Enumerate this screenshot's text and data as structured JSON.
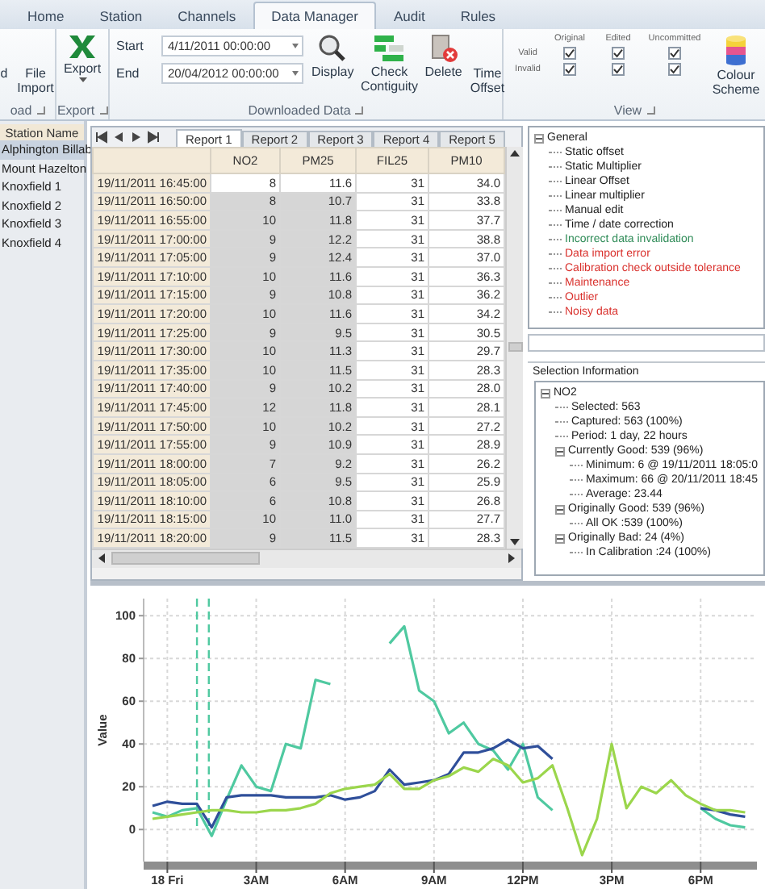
{
  "ribbon": {
    "tabs": [
      {
        "label": "Home",
        "selected": false
      },
      {
        "label": "Station",
        "selected": false
      },
      {
        "label": "Channels",
        "selected": false
      },
      {
        "label": "Data Manager",
        "selected": true
      },
      {
        "label": "Audit",
        "selected": false
      },
      {
        "label": "Rules",
        "selected": false
      }
    ],
    "load_group": {
      "label": "oad",
      "buttons": [
        "d",
        "File Import"
      ]
    },
    "export_group": {
      "label": "Export",
      "button": "Export"
    },
    "downloaded_group": {
      "label": "Downloaded Data",
      "start_label": "Start",
      "start_value": "4/11/2011 00:00:00",
      "end_label": "End",
      "end_value": "20/04/2012 00:00:00",
      "buttons": [
        {
          "kind": "display",
          "label": "Display"
        },
        {
          "kind": "contiguity",
          "label": "Check Contiguity"
        },
        {
          "kind": "delete",
          "label": "Delete"
        },
        {
          "kind": "plain",
          "label": "Time Offset"
        }
      ]
    },
    "view_group": {
      "label": "View",
      "columns": [
        "Original",
        "Edited",
        "Uncommitted"
      ],
      "rows": [
        {
          "label": "Valid",
          "checks": [
            true,
            true,
            true
          ]
        },
        {
          "label": "Invalid",
          "checks": [
            true,
            true,
            true
          ]
        }
      ],
      "button": "Colour Scheme"
    }
  },
  "stations": {
    "header": "Station Name",
    "items": [
      {
        "label": "Alphington Billab",
        "selected": true
      },
      {
        "label": "Mount Hazelton",
        "selected": false
      },
      {
        "label": "Knoxfield 1",
        "selected": false
      },
      {
        "label": "Knoxfield 2",
        "selected": false
      },
      {
        "label": "Knoxfield 3",
        "selected": false
      },
      {
        "label": "Knoxfield 4",
        "selected": false
      }
    ]
  },
  "report_tabs": [
    {
      "label": "Report 1",
      "selected": true
    },
    {
      "label": "Report 2",
      "selected": false
    },
    {
      "label": "Report 3",
      "selected": false
    },
    {
      "label": "Report 4",
      "selected": false
    },
    {
      "label": "Report 5",
      "selected": false
    }
  ],
  "table": {
    "columns": [
      "NO2",
      "PM25",
      "FIL25",
      "PM10"
    ],
    "rows": [
      {
        "time": "19/11/2011 16:45:00",
        "values": [
          "8",
          "11.6",
          "31",
          "34.0"
        ],
        "selected": false
      },
      {
        "time": "19/11/2011 16:50:00",
        "values": [
          "8",
          "10.7",
          "31",
          "33.8"
        ],
        "selected": true
      },
      {
        "time": "19/11/2011 16:55:00",
        "values": [
          "10",
          "11.8",
          "31",
          "37.7"
        ],
        "selected": true
      },
      {
        "time": "19/11/2011 17:00:00",
        "values": [
          "9",
          "12.2",
          "31",
          "38.8"
        ],
        "selected": true
      },
      {
        "time": "19/11/2011 17:05:00",
        "values": [
          "9",
          "12.4",
          "31",
          "37.0"
        ],
        "selected": true
      },
      {
        "time": "19/11/2011 17:10:00",
        "values": [
          "10",
          "11.6",
          "31",
          "36.3"
        ],
        "selected": true
      },
      {
        "time": "19/11/2011 17:15:00",
        "values": [
          "9",
          "10.8",
          "31",
          "36.2"
        ],
        "selected": true
      },
      {
        "time": "19/11/2011 17:20:00",
        "values": [
          "10",
          "11.6",
          "31",
          "34.2"
        ],
        "selected": true
      },
      {
        "time": "19/11/2011 17:25:00",
        "values": [
          "9",
          "9.5",
          "31",
          "30.5"
        ],
        "selected": true
      },
      {
        "time": "19/11/2011 17:30:00",
        "values": [
          "10",
          "11.3",
          "31",
          "29.7"
        ],
        "selected": true
      },
      {
        "time": "19/11/2011 17:35:00",
        "values": [
          "10",
          "11.5",
          "31",
          "28.3"
        ],
        "selected": true
      },
      {
        "time": "19/11/2011 17:40:00",
        "values": [
          "9",
          "10.2",
          "31",
          "28.0"
        ],
        "selected": true
      },
      {
        "time": "19/11/2011 17:45:00",
        "values": [
          "12",
          "11.8",
          "31",
          "28.1"
        ],
        "selected": true
      },
      {
        "time": "19/11/2011 17:50:00",
        "values": [
          "10",
          "10.2",
          "31",
          "27.2"
        ],
        "selected": true
      },
      {
        "time": "19/11/2011 17:55:00",
        "values": [
          "9",
          "10.9",
          "31",
          "28.9"
        ],
        "selected": true
      },
      {
        "time": "19/11/2011 18:00:00",
        "values": [
          "7",
          "9.2",
          "31",
          "26.2"
        ],
        "selected": true
      },
      {
        "time": "19/11/2011 18:05:00",
        "values": [
          "6",
          "9.5",
          "31",
          "25.9"
        ],
        "selected": true
      },
      {
        "time": "19/11/2011 18:10:00",
        "values": [
          "6",
          "10.8",
          "31",
          "26.8"
        ],
        "selected": true
      },
      {
        "time": "19/11/2011 18:15:00",
        "values": [
          "10",
          "11.0",
          "31",
          "27.7"
        ],
        "selected": true
      },
      {
        "time": "19/11/2011 18:20:00",
        "values": [
          "9",
          "11.5",
          "31",
          "28.3"
        ],
        "selected": true
      }
    ]
  },
  "flags_tree": [
    {
      "label": "General",
      "expanded": true,
      "children": [
        {
          "label": "Static offset",
          "color": "#1a1a1a"
        },
        {
          "label": "Static Multiplier",
          "color": "#1a1a1a"
        },
        {
          "label": "Linear Offset",
          "color": "#1a1a1a"
        },
        {
          "label": "Linear multiplier",
          "color": "#1a1a1a"
        },
        {
          "label": "Manual edit",
          "color": "#1a1a1a"
        },
        {
          "label": "Time / date correction",
          "color": "#1a1a1a"
        },
        {
          "label": "Incorrect data invalidation",
          "color": "#2e8b57"
        },
        {
          "label": "Data import error",
          "color": "#d9302c"
        },
        {
          "label": "Calibration check outside tolerance",
          "color": "#d9302c"
        },
        {
          "label": "Maintenance",
          "color": "#d9302c"
        },
        {
          "label": "Outlier",
          "color": "#d9302c"
        },
        {
          "label": "Noisy data",
          "color": "#d9302c"
        }
      ]
    }
  ],
  "selection_info": {
    "title": "Selection Information",
    "tree": [
      {
        "label": "NO2",
        "expanded": true,
        "children": [
          {
            "label": "Selected: 563"
          },
          {
            "label": "Captured: 563 (100%)"
          },
          {
            "label": "Period: 1 day, 22 hours"
          },
          {
            "label": "Currently Good: 539 (96%)",
            "expanded": true,
            "children": [
              {
                "label": "Minimum: 6 @ 19/11/2011 18:05:0"
              },
              {
                "label": "Maximum: 66 @ 20/11/2011 18:45"
              },
              {
                "label": "Average: 23.44"
              }
            ]
          },
          {
            "label": "Originally Good: 539 (96%)",
            "expanded": true,
            "children": [
              {
                "label": "All OK :539 (100%)"
              }
            ]
          },
          {
            "label": "Originally Bad: 24 (4%)",
            "expanded": true,
            "children": [
              {
                "label": "In Calibration :24 (100%)"
              }
            ]
          }
        ]
      }
    ]
  },
  "chart": {
    "chart_data": {
      "type": "line",
      "ylabel": "Value",
      "grid": true,
      "x": [
        "2011-11-17T23:30",
        "2011-11-18T00:00",
        "2011-11-18T00:30",
        "2011-11-18T01:00",
        "2011-11-18T01:30",
        "2011-11-18T02:00",
        "2011-11-18T02:30",
        "2011-11-18T03:00",
        "2011-11-18T03:30",
        "2011-11-18T04:00",
        "2011-11-18T04:30",
        "2011-11-18T05:00",
        "2011-11-18T05:30",
        "2011-11-18T06:00",
        "2011-11-18T06:30",
        "2011-11-18T07:00",
        "2011-11-18T07:30",
        "2011-11-18T08:00",
        "2011-11-18T08:30",
        "2011-11-18T09:00",
        "2011-11-18T09:30",
        "2011-11-18T10:00",
        "2011-11-18T10:30",
        "2011-11-18T11:00",
        "2011-11-18T11:30",
        "2011-11-18T12:00",
        "2011-11-18T12:30",
        "2011-11-18T13:00",
        "2011-11-18T13:30",
        "2011-11-18T14:00",
        "2011-11-18T14:30",
        "2011-11-18T15:00",
        "2011-11-18T15:30",
        "2011-11-18T16:00",
        "2011-11-18T16:30",
        "2011-11-18T17:00",
        "2011-11-18T17:30",
        "2011-11-18T18:00",
        "2011-11-18T18:30",
        "2011-11-18T19:00",
        "2011-11-18T19:30"
      ],
      "series": [
        {
          "color": "#4fc9a0",
          "values": [
            8,
            6,
            9,
            10,
            -3,
            14,
            30,
            20,
            18,
            40,
            38,
            70,
            68,
            null,
            null,
            null,
            87,
            95,
            65,
            60,
            45,
            50,
            40,
            37,
            28,
            40,
            15,
            9,
            null,
            null,
            null,
            null,
            null,
            null,
            null,
            null,
            null,
            10,
            5,
            2,
            1
          ]
        },
        {
          "color": "#2f4f9a",
          "values": [
            11,
            13,
            12,
            12,
            1,
            15,
            16,
            16,
            16,
            15,
            15,
            15,
            16,
            14,
            15,
            18,
            28,
            21,
            22,
            23,
            26,
            36,
            36,
            38,
            42,
            38,
            39,
            33,
            null,
            null,
            null,
            null,
            null,
            null,
            null,
            null,
            null,
            10,
            9,
            7,
            6
          ]
        },
        {
          "color": "#9bd64c",
          "values": [
            5,
            6,
            7,
            8,
            9,
            9,
            8,
            8,
            9,
            9,
            10,
            12,
            17,
            19,
            20,
            21,
            26,
            19,
            19,
            23,
            25,
            29,
            27,
            33,
            30,
            22,
            24,
            30,
            10,
            -12,
            5,
            40,
            10,
            20,
            17,
            23,
            16,
            12,
            9,
            9,
            8
          ]
        }
      ],
      "xlim": [
        "2011-11-17T23:12",
        "2011-11-18T19:54"
      ],
      "ylim": [
        -15,
        108
      ],
      "xticks": [
        {
          "value": "2011-11-18T00:00",
          "label": "18 Fri"
        },
        {
          "value": "2011-11-18T03:00",
          "label": "3AM"
        },
        {
          "value": "2011-11-18T06:00",
          "label": "6AM"
        },
        {
          "value": "2011-11-18T09:00",
          "label": "9AM"
        },
        {
          "value": "2011-11-18T12:00",
          "label": "12PM"
        },
        {
          "value": "2011-11-18T15:00",
          "label": "3PM"
        },
        {
          "value": "2011-11-18T18:00",
          "label": "6PM"
        }
      ],
      "yticks": [
        0,
        20,
        40,
        60,
        80,
        100
      ],
      "ref_lines": [
        {
          "axis": "x",
          "value": "2011-11-18T01:00"
        },
        {
          "axis": "x",
          "value": "2011-11-18T01:24"
        }
      ]
    }
  }
}
